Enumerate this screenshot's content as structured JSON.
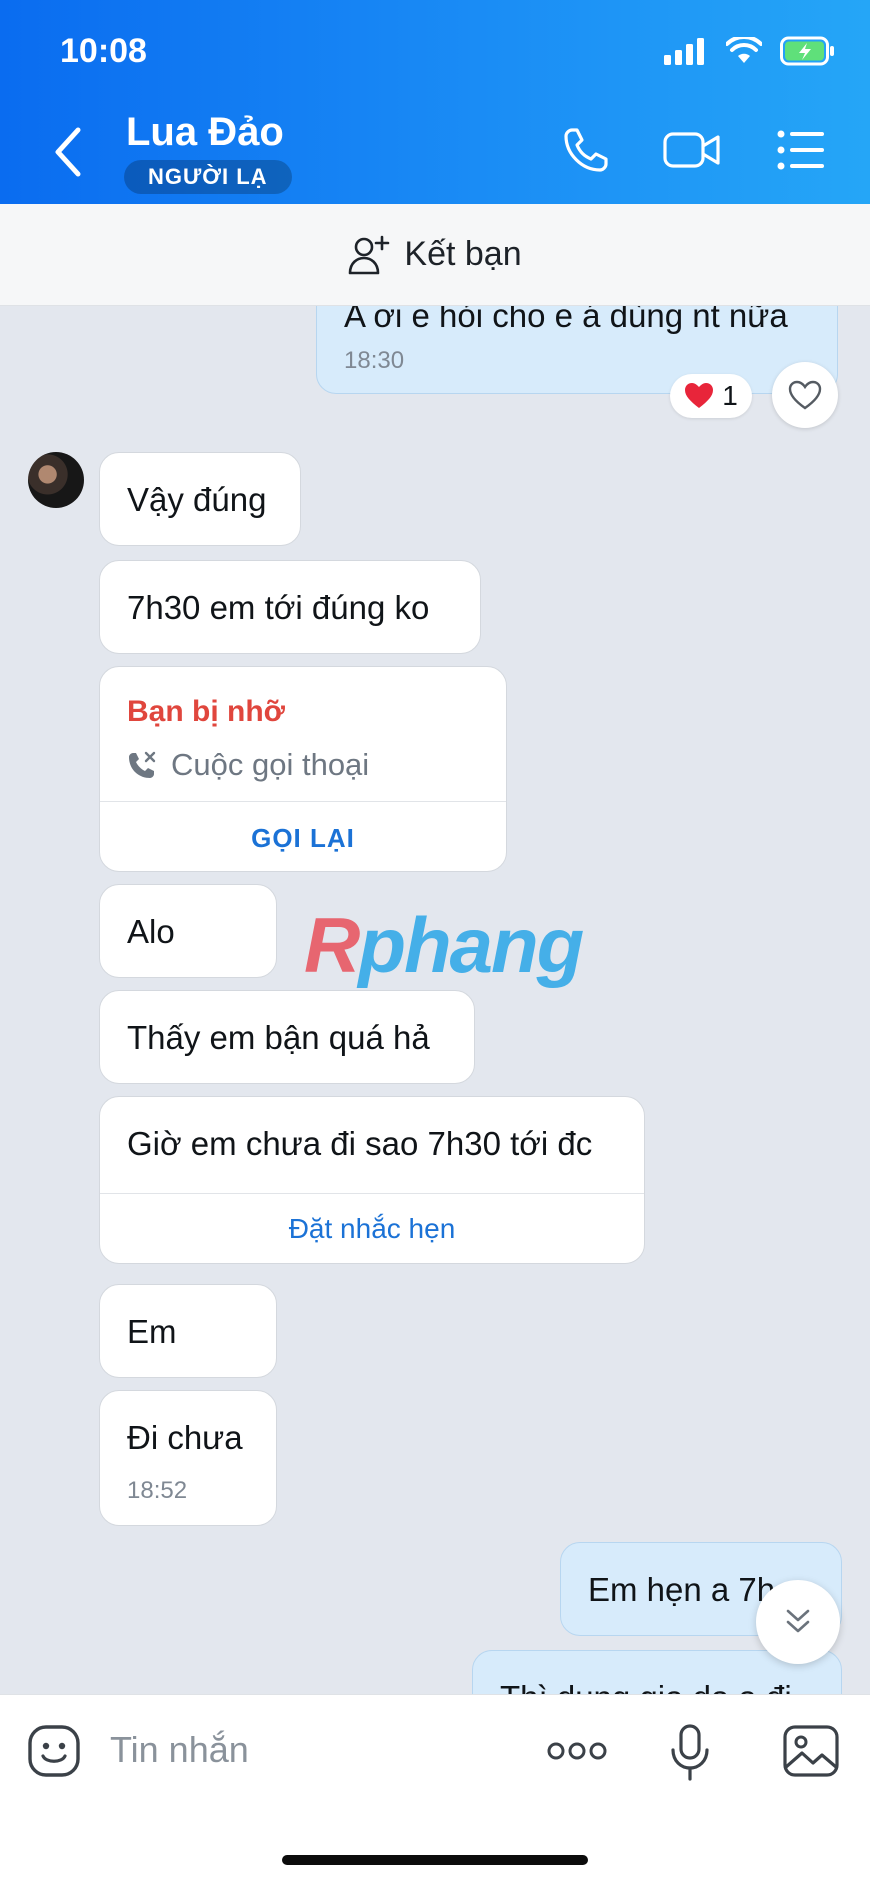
{
  "status": {
    "time": "10:08"
  },
  "header": {
    "contact_name": "Lua Đảo",
    "badge": "NGƯỜI LẠ"
  },
  "add_friend": {
    "label": "Kết bạn"
  },
  "messages": {
    "top_partial": {
      "text": "A ơi e hỏi cho e á dùng nt nữa",
      "time": "18:30",
      "reaction_count": "1"
    },
    "m1": "Vậy đúng",
    "m2": "7h30 em tới đúng ko",
    "missed": {
      "title": "Bạn bị nhỡ",
      "subtitle": "Cuộc gọi thoại",
      "action": "GỌI LẠI"
    },
    "m3": "Alo",
    "m4": "Thấy em bận quá hả",
    "m5": {
      "text": "Giờ em chưa đi sao 7h30 tới đc",
      "action": "Đặt nhắc hẹn"
    },
    "m6": "Em",
    "m7": {
      "text": "Đi chưa",
      "time": "18:52"
    },
    "me1": "Em hẹn a 7h",
    "me2_partial": "Thì dung gia dạ a đi"
  },
  "watermark": {
    "first": "R",
    "rest": "phang"
  },
  "composer": {
    "placeholder": "Tin nhắn"
  },
  "colors": {
    "header_start": "#0a6cf0",
    "header_end": "#25a6f7",
    "link": "#1b72d6",
    "missed": "#e0463d",
    "my_bubble": "#d7ebfb"
  }
}
